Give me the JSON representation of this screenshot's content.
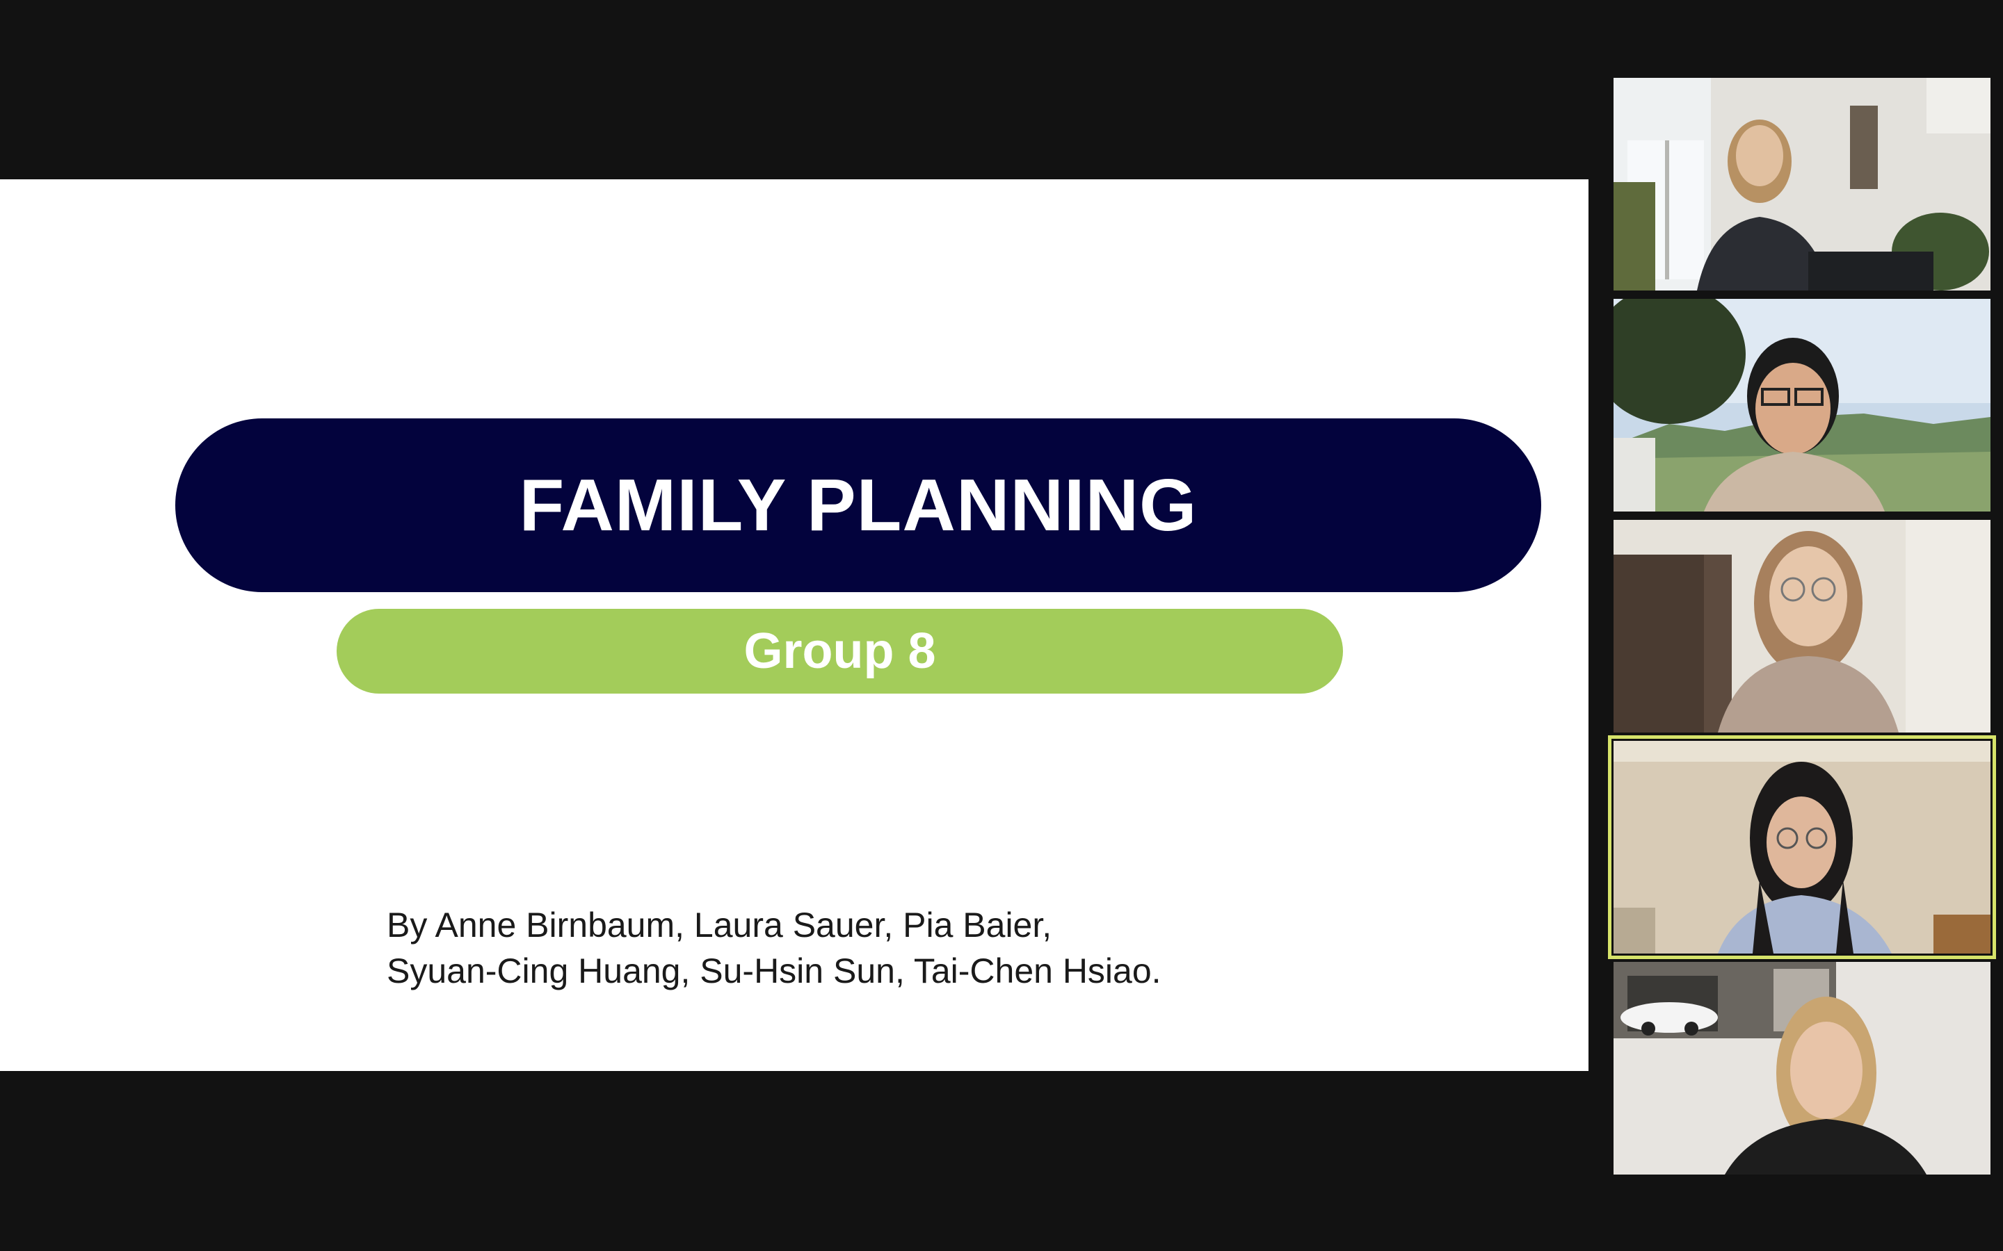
{
  "slide": {
    "title": "FAMILY PLANNING",
    "subtitle": "Group 8",
    "authors_line1": "By Anne Birnbaum, Laura Sauer, Pia Baier,",
    "authors_line2": "Syuan-Cing Huang, Su-Hsin Sun, Tai-Chen Hsiao.",
    "colors": {
      "title_bg": "#03033d",
      "subtitle_bg": "#a3cc5a",
      "slide_bg": "#ffffff"
    }
  },
  "participants": [
    {
      "video_icon": "participant-video-1",
      "active": false
    },
    {
      "video_icon": "participant-video-2",
      "active": false
    },
    {
      "video_icon": "participant-video-3",
      "active": false
    },
    {
      "video_icon": "participant-video-4",
      "active": true
    },
    {
      "video_icon": "participant-video-5",
      "active": false
    }
  ],
  "colors": {
    "background": "#121212",
    "active_speaker_border": "#d6e36a"
  }
}
